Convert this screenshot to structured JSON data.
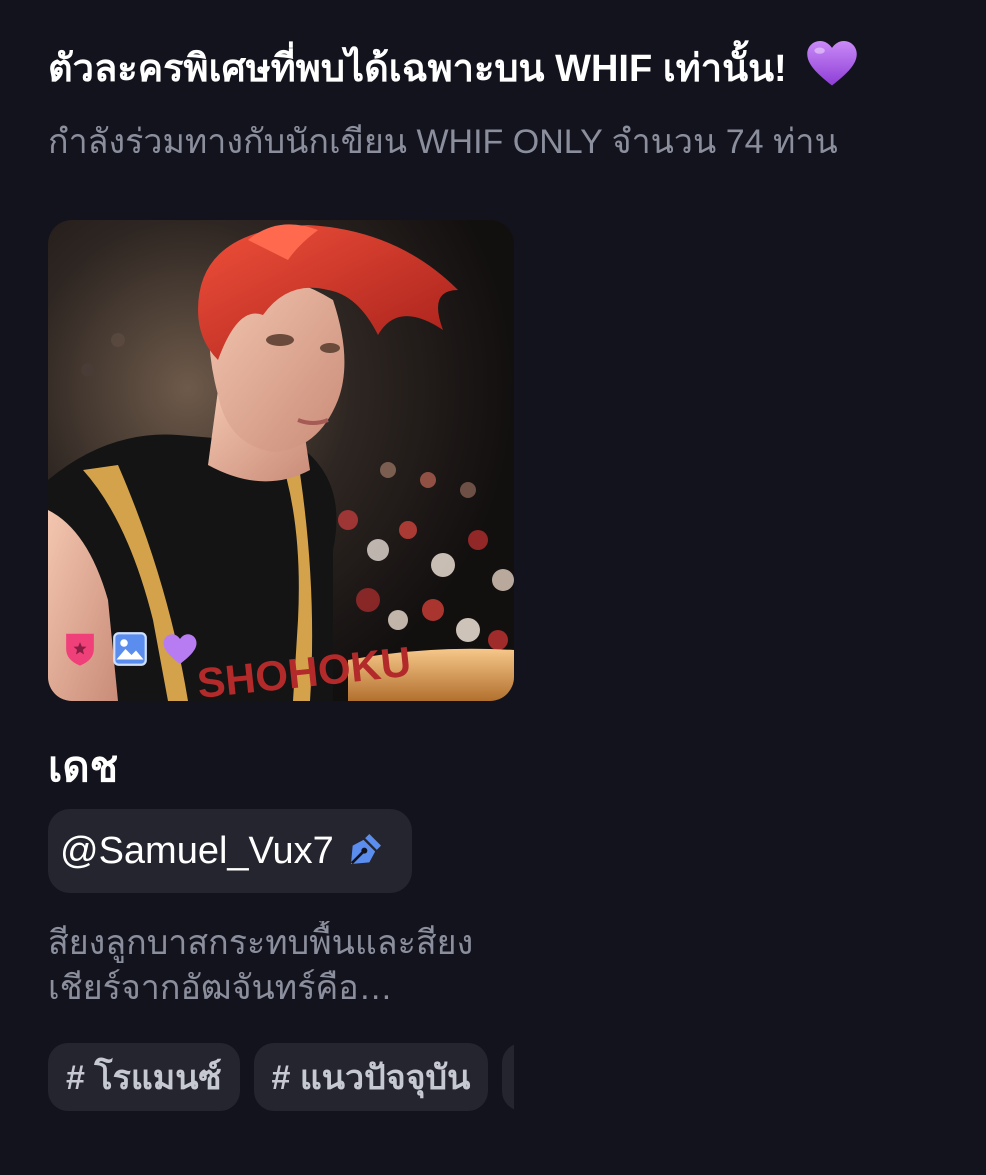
{
  "section": {
    "title": "ตัวละครพิเศษที่พบได้เฉพาะบน WHIF เท่านั้น!",
    "title_emoji": "purple-heart-icon",
    "subtitle": "กำลังร่วมทางกับนักเขียน WHIF ONLY จำนวน 74 ท่าน"
  },
  "card": {
    "name": "เดช",
    "author": "@Samuel_Vux7",
    "author_icon": "pen-nib-icon",
    "description": "สียงลูกบาสกระทบพื้นและสียงเชียร์จากอัฒจันทร์คือ…",
    "badges": [
      "pink-shield-badge-icon",
      "image-badge-icon",
      "purple-heart-badge-icon"
    ],
    "tags": [
      "# โรแมนซ์",
      "# แนวปัจจุบัน",
      "#"
    ]
  },
  "colors": {
    "background": "#13131d",
    "chip": "#25252f",
    "muted_text": "#8b8e9c",
    "accent_purple": "#b77cf2",
    "accent_pink": "#f0407a",
    "accent_blue": "#5b8def"
  }
}
